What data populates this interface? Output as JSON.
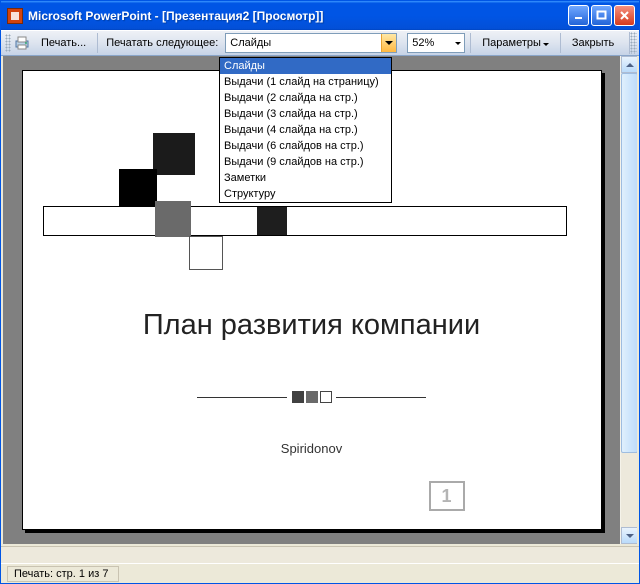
{
  "window": {
    "title": "Microsoft PowerPoint - [Презентация2 [Просмотр]]"
  },
  "toolbar": {
    "print_label": "Печать...",
    "print_what_label": "Печатать следующее:",
    "print_what_value": "Слайды",
    "print_what_options": [
      "Слайды",
      "Выдачи (1 слайд на страницу)",
      "Выдачи (2 слайда на стр.)",
      "Выдачи (3 слайда на стр.)",
      "Выдачи (4 слайда на стр.)",
      "Выдачи (6 слайдов на стр.)",
      "Выдачи (9 слайдов на стр.)",
      "Заметки",
      "Структуру"
    ],
    "zoom_value": "52%",
    "options_label": "Параметры",
    "close_label": "Закрыть"
  },
  "slide": {
    "title": "План развития компании",
    "author": "Spiridonov",
    "page_number": "1"
  },
  "status": {
    "text": "Печать: стр. 1 из 7"
  }
}
